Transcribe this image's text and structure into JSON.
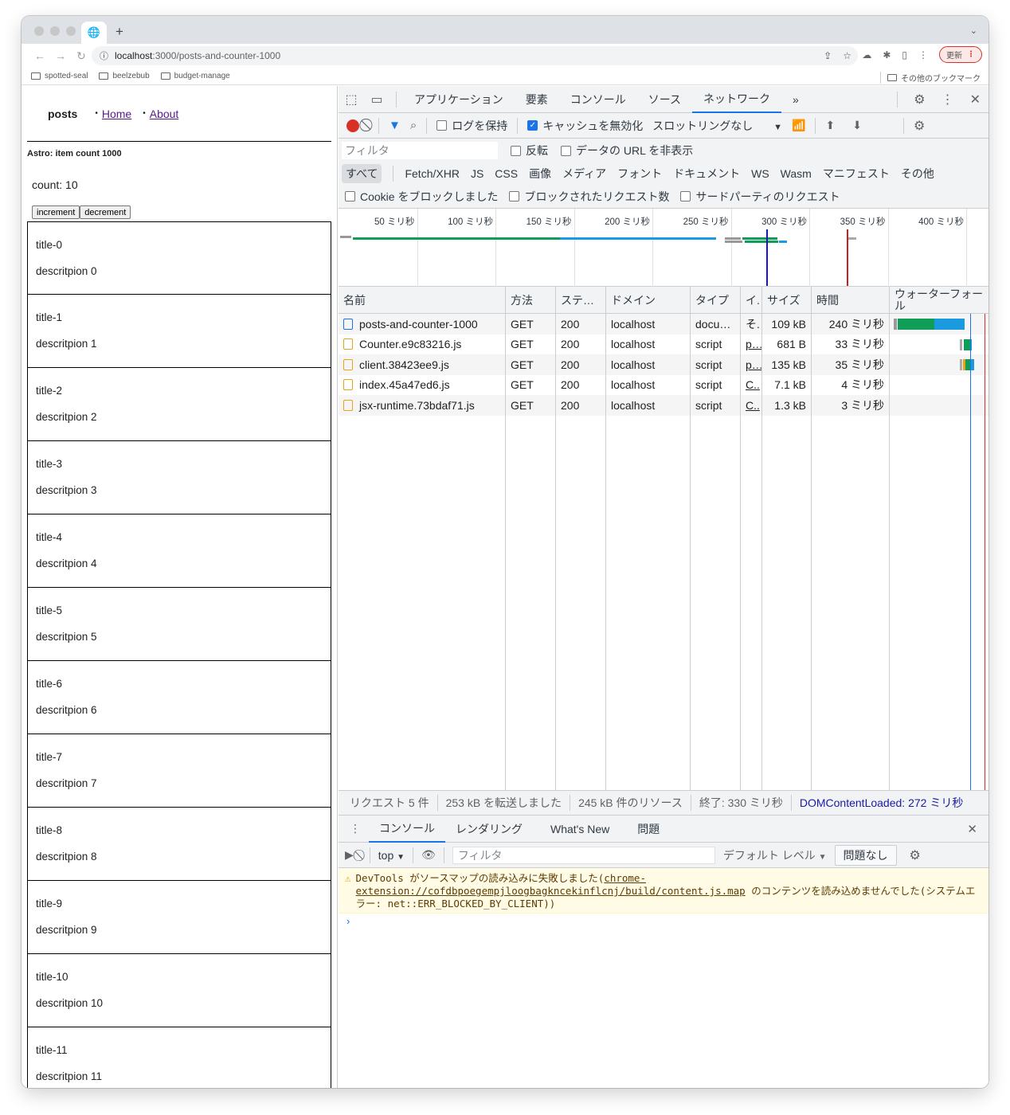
{
  "browser": {
    "tab_icon": "globe-icon",
    "new_tab": "+",
    "url_host": "localhost",
    "url_rest": ":3000/posts-and-counter-1000",
    "update_label": "更新",
    "bookmarks": [
      "spotted-seal",
      "beelzebub",
      "budget-manage"
    ],
    "other_bookmarks": "その他のブックマーク"
  },
  "page": {
    "brand": "posts",
    "nav": [
      "Home",
      "About"
    ],
    "astro_label": "Astro: item count 1000",
    "count_label": "count: 10",
    "increment": "increment",
    "decrement": "decrement",
    "posts": [
      {
        "title": "title-0",
        "desc": "descritpion 0"
      },
      {
        "title": "title-1",
        "desc": "descritpion 1"
      },
      {
        "title": "title-2",
        "desc": "descritpion 2"
      },
      {
        "title": "title-3",
        "desc": "descritpion 3"
      },
      {
        "title": "title-4",
        "desc": "descritpion 4"
      },
      {
        "title": "title-5",
        "desc": "descritpion 5"
      },
      {
        "title": "title-6",
        "desc": "descritpion 6"
      },
      {
        "title": "title-7",
        "desc": "descritpion 7"
      },
      {
        "title": "title-8",
        "desc": "descritpion 8"
      },
      {
        "title": "title-9",
        "desc": "descritpion 9"
      },
      {
        "title": "title-10",
        "desc": "descritpion 10"
      },
      {
        "title": "title-11",
        "desc": "descritpion 11"
      }
    ]
  },
  "devtools": {
    "tabs": [
      "アプリケーション",
      "要素",
      "コンソール",
      "ソース",
      "ネットワーク"
    ],
    "active_tab": "ネットワーク",
    "more": "»",
    "network_toolbar": {
      "preserve_log": "ログを保持",
      "disable_cache": "キャッシュを無効化",
      "throttling": "スロットリングなし"
    },
    "filter_placeholder": "フィルタ",
    "invert": "反転",
    "hide_data_urls": "データの URL を非表示",
    "type_filters": [
      "すべて",
      "Fetch/XHR",
      "JS",
      "CSS",
      "画像",
      "メディア",
      "フォント",
      "ドキュメント",
      "WS",
      "Wasm",
      "マニフェスト",
      "その他"
    ],
    "blocked_cookies": "Cookie をブロックしました",
    "blocked_requests": "ブロックされたリクエスト数",
    "third_party": "サードパーティのリクエスト",
    "timeline_ticks": [
      "50 ミリ秒",
      "100 ミリ秒",
      "150 ミリ秒",
      "200 ミリ秒",
      "250 ミリ秒",
      "300 ミリ秒",
      "350 ミリ秒",
      "400 ミリ秒"
    ],
    "columns": [
      "名前",
      "方法",
      "ステ…",
      "ドメイン",
      "タイプ",
      "イ.",
      "サイズ",
      "時間",
      "ウォーターフォール"
    ],
    "requests": [
      {
        "name": "posts-and-counter-1000",
        "method": "GET",
        "status": "200",
        "domain": "localhost",
        "type": "docu…",
        "initiator": "そ.",
        "size": "109 kB",
        "time": "240 ミリ秒",
        "kind": "doc"
      },
      {
        "name": "Counter.e9c83216.js",
        "method": "GET",
        "status": "200",
        "domain": "localhost",
        "type": "script",
        "initiator": "p…",
        "size": "681 B",
        "time": "33 ミリ秒",
        "kind": "js"
      },
      {
        "name": "client.38423ee9.js",
        "method": "GET",
        "status": "200",
        "domain": "localhost",
        "type": "script",
        "initiator": "p…",
        "size": "135 kB",
        "time": "35 ミリ秒",
        "kind": "js"
      },
      {
        "name": "index.45a47ed6.js",
        "method": "GET",
        "status": "200",
        "domain": "localhost",
        "type": "script",
        "initiator": "C..",
        "size": "7.1 kB",
        "time": "4 ミリ秒",
        "kind": "js"
      },
      {
        "name": "jsx-runtime.73bdaf71.js",
        "method": "GET",
        "status": "200",
        "domain": "localhost",
        "type": "script",
        "initiator": "C..",
        "size": "1.3 kB",
        "time": "3 ミリ秒",
        "kind": "js"
      }
    ],
    "status_bar": {
      "requests": "リクエスト 5 件",
      "transferred": "253 kB を転送しました",
      "resources": "245 kB 件のリソース",
      "finish": "終了: 330 ミリ秒",
      "dcl": "DOMContentLoaded: 272 ミリ秒"
    },
    "drawer": {
      "tabs": [
        "コンソール",
        "レンダリング",
        "What's New",
        "問題"
      ],
      "context": "top",
      "filter_placeholder": "フィルタ",
      "levels": "デフォルト レベル",
      "issues": "問題なし",
      "warning_prefix": "DevTools がソースマップの読み込みに失敗しました(",
      "warning_link": "chrome-extension://cofdbpoegempjloogbagkncekinflcnj/build/content.js.map",
      "warning_suffix": " のコンテンツを読み込めませんでした(システムエラー: net::ERR_BLOCKED_BY_CLIENT))",
      "prompt": "›"
    },
    "colors": {
      "accent": "#1a73e8",
      "record": "#d93025",
      "waiting": "#0f9d58",
      "download": "#1a9be0"
    }
  }
}
